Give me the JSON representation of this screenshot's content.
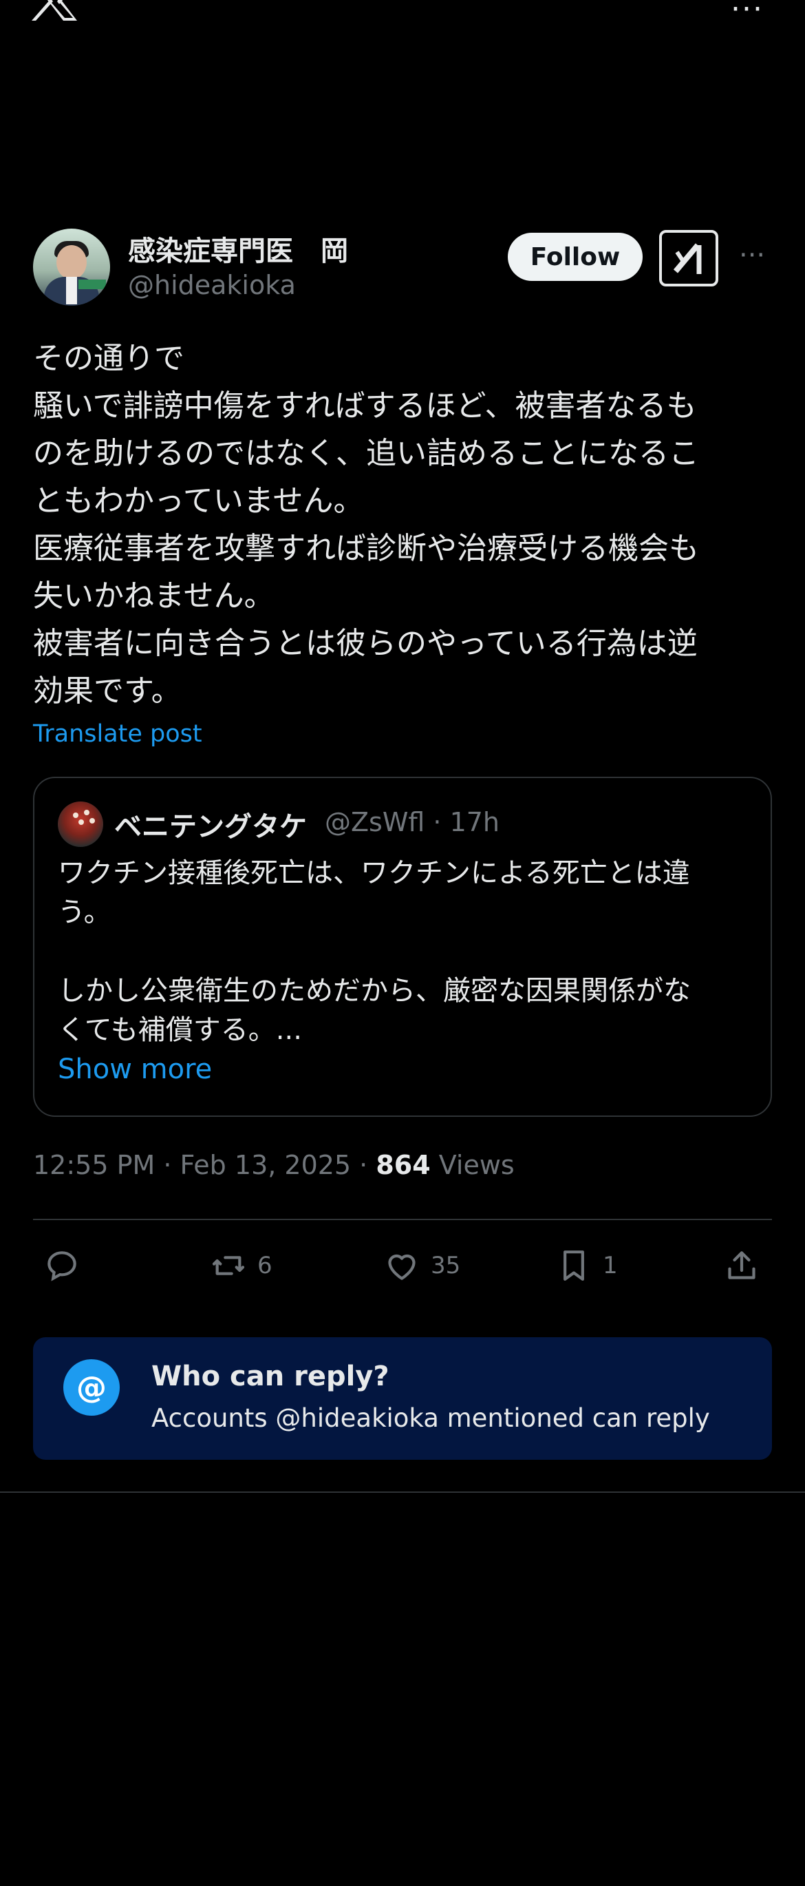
{
  "header": {
    "more_glyph": "···"
  },
  "author": {
    "name": "感染症専門医　岡",
    "handle": "@hideakioka",
    "follow_label": "Follow",
    "more_glyph": "···"
  },
  "tweet": {
    "text": "その通りで\n騒いで誹謗中傷をすればするほど、被害者なるも\nのを助けるのではなく、追い詰めることになるこ\nともわかっていません。\n医療従事者を攻撃すれば診断や治療受ける機会も\n失いかねません。\n被害者に向き合うとは彼らのやっている行為は逆\n効果です。",
    "translate_label": "Translate post"
  },
  "quoted": {
    "name": "ベニテングタケ",
    "meta": "@ZsWfl · 17h",
    "text": "ワクチン接種後死亡は、ワクチンによる死亡とは違\nう。\n\nしかし公衆衛生のためだから、厳密な因果関係がな\nくても補償する。...",
    "show_more": "Show more"
  },
  "meta": {
    "timestamp": "12:55 PM · Feb 13, 2025 · ",
    "views_count": "864",
    "views_label": " Views"
  },
  "actions": {
    "reply_count": "",
    "retweet_count": "6",
    "like_count": "35",
    "bookmark_count": "1"
  },
  "who_can_reply": {
    "icon_glyph": "@",
    "title": "Who can reply?",
    "subtitle": "Accounts @hideakioka mentioned can reply"
  },
  "colors": {
    "background": "#000000",
    "text": "#e7e9ea",
    "muted": "#71767b",
    "accent": "#1d9bf0",
    "reply_box": "#031640"
  }
}
